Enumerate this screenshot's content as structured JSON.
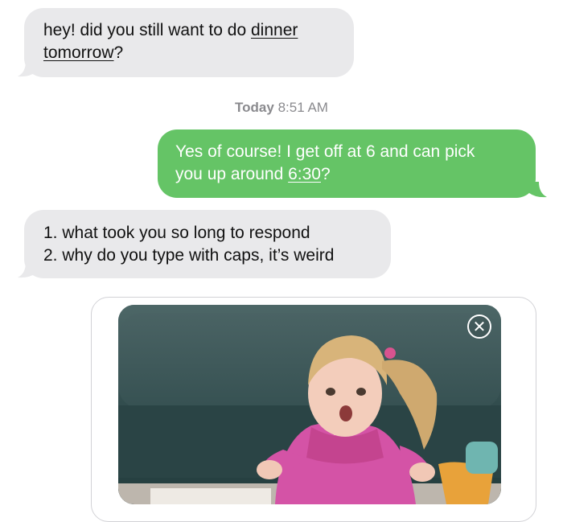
{
  "messages": [
    {
      "direction": "incoming",
      "lines": [
        {
          "before": "hey! did you still want to do ",
          "link": "dinner"
        },
        {
          "link": "tomorrow",
          "after": "?"
        }
      ]
    },
    {
      "direction": "outgoing",
      "lines": [
        {
          "text": "Yes of course! I get off at 6 and can pick"
        },
        {
          "before": "you up around ",
          "link": "6:30",
          "after": "?"
        }
      ]
    },
    {
      "direction": "incoming",
      "lines": [
        {
          "text": "1. what took you so long to respond"
        },
        {
          "text": "2. why do you type with caps, it’s weird"
        }
      ]
    }
  ],
  "timestamp": {
    "day": "Today",
    "time": "8:51 AM"
  },
  "gif_attachment": {
    "description_icon": "gif-preview",
    "close_icon": "close-circle-icon",
    "close_glyph": "✕"
  },
  "colors": {
    "incoming_bubble": "#e9e9eb",
    "outgoing_bubble": "#65c466",
    "timestamp_text": "#8a8a8e"
  }
}
